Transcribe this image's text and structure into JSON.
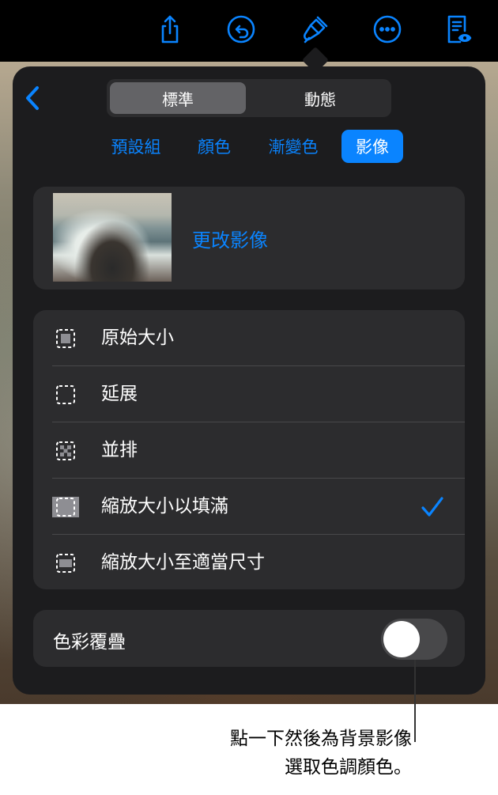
{
  "toolbar": {
    "icons": [
      "share-icon",
      "undo-icon",
      "paintbrush-icon",
      "more-icon",
      "reading-view-icon"
    ]
  },
  "segmented": {
    "items": [
      "標準",
      "動態"
    ],
    "selected": "標準"
  },
  "tabs": {
    "items": [
      "預設組",
      "顏色",
      "漸變色",
      "影像"
    ],
    "selected": "影像"
  },
  "image_card": {
    "change_label": "更改影像"
  },
  "scale_options": {
    "items": [
      {
        "label": "原始大小",
        "icon": "original-size-icon"
      },
      {
        "label": "延展",
        "icon": "stretch-icon"
      },
      {
        "label": "並排",
        "icon": "tile-icon"
      },
      {
        "label": "縮放大小以填滿",
        "icon": "scale-to-fill-icon"
      },
      {
        "label": "縮放大小至適當尺寸",
        "icon": "scale-to-fit-icon"
      }
    ],
    "selected": "縮放大小以填滿"
  },
  "color_overlay": {
    "label": "色彩覆疊",
    "enabled": false
  },
  "callout": {
    "line1": "點一下然後為背景影像",
    "line2": "選取色調顏色。"
  },
  "colors": {
    "accent": "#0a84ff",
    "panel": "#1c1c1e",
    "card": "#2c2c2e"
  }
}
